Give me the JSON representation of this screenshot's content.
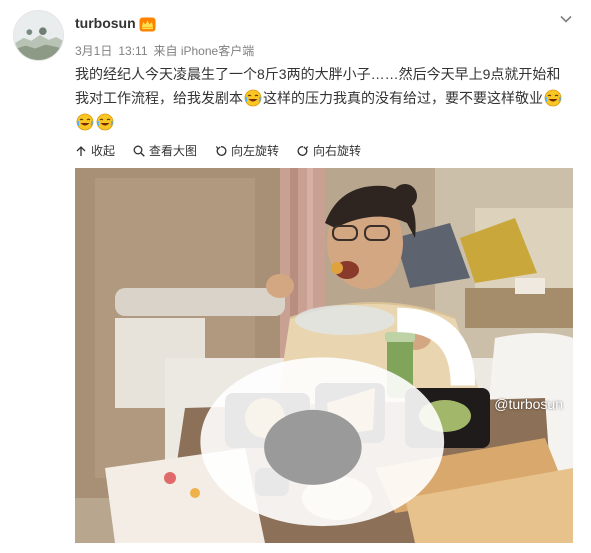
{
  "author": {
    "name": "turbosun",
    "badge_icon": "vip-crown-icon"
  },
  "meta": {
    "date": "3月1日",
    "time": "13:11",
    "source": "来自 iPhone客户端"
  },
  "post": {
    "text_1": "我的经纪人今天凌晨生了一个8斤3两的大胖小子……然后今天早上9点就开始和我对工作流程，给我发剧本",
    "text_2": "这样的压力我真的没有给过，要不要这样敬业",
    "emoji_name": "laugh-cry-emoji-icon"
  },
  "toolbar": {
    "collapse": "收起",
    "view_large": "查看大图",
    "rotate_left": "向左旋转",
    "rotate_right": "向右旋转"
  },
  "photo": {
    "watermark": "@turbosun"
  },
  "colors": {
    "text": "#333333",
    "meta": "#808080",
    "accent_orange": "#ff8200"
  }
}
